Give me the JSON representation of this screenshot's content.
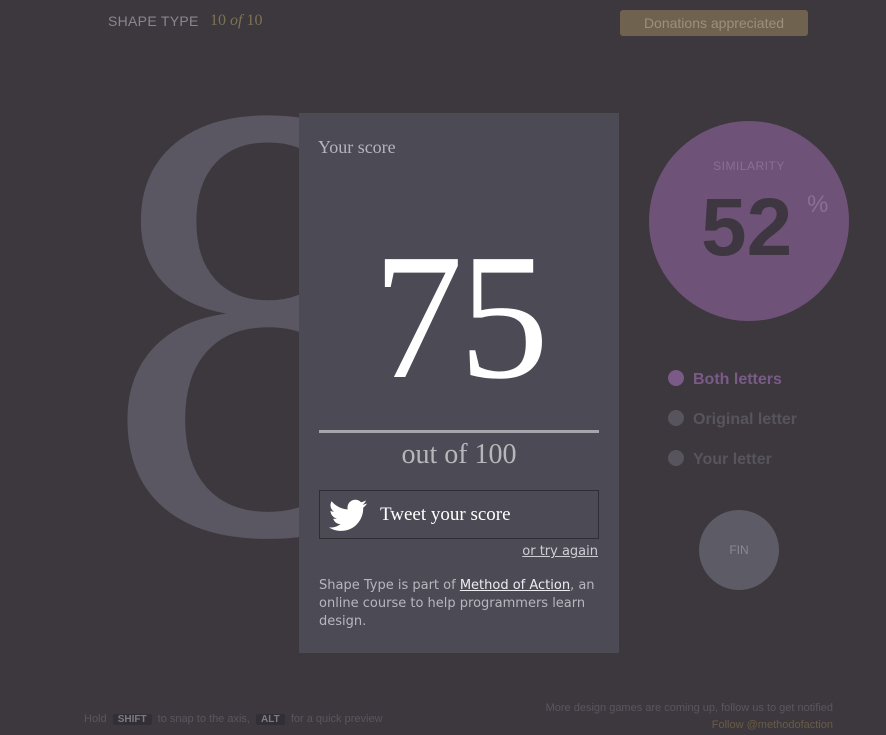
{
  "header": {
    "title": "SHAPE TYPE",
    "progress_current": "10",
    "progress_of": "of",
    "progress_total": "10",
    "donate_label": "Donations appreciated"
  },
  "canvas": {
    "letter": "8"
  },
  "result": {
    "heading": "Your score",
    "score": "75",
    "out_of": "out of 100",
    "tweet_label": "Tweet your score",
    "try_again": "or try again",
    "blurb_prefix": "Shape Type is part of ",
    "blurb_link": "Method of Action",
    "blurb_suffix": ", an online course to help programmers learn design."
  },
  "similarity": {
    "label": "SIMILARITY",
    "value": "52",
    "unit": "%"
  },
  "view_options": [
    {
      "label": "Both letters",
      "selected": true,
      "color": "#7a5a86"
    },
    {
      "label": "Original letter",
      "selected": false,
      "color": "#57545d"
    },
    {
      "label": "Your letter",
      "selected": false,
      "color": "#57545d"
    }
  ],
  "fin_label": "FIN",
  "footer": {
    "hint_hold": "Hold",
    "hint_key1": "SHIFT",
    "hint_mid": "to snap to the axis,",
    "hint_key2": "ALT",
    "hint_end": "for a quick preview",
    "notice": "More design games are coming up, follow us to get notified",
    "follow": "Follow @methodofaction"
  },
  "colors": {
    "background": "#3c383e",
    "panel": "#4c4b55",
    "accent_purple": "#6e5277",
    "donate": "#6f6350"
  }
}
